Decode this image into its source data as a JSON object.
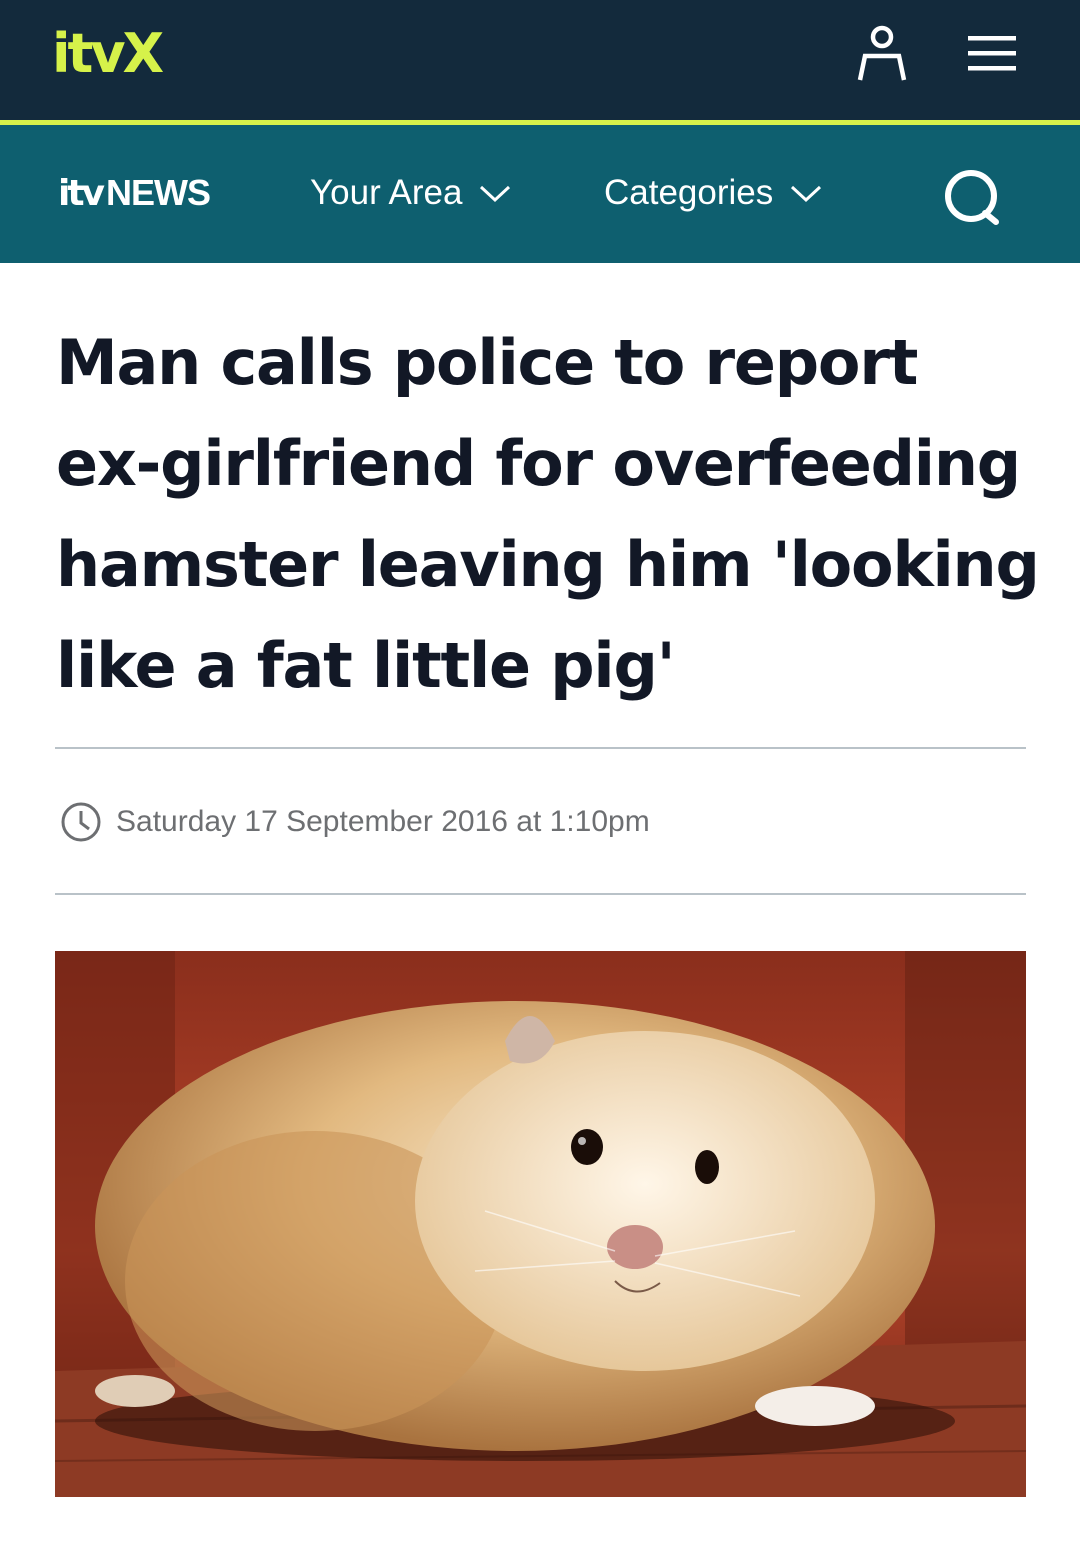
{
  "top_bar": {
    "logo": "itvX",
    "account_icon": "user-icon",
    "menu_icon": "hamburger-menu-icon"
  },
  "news_nav": {
    "logo_prefix": "itv",
    "logo_word": "NEWS",
    "items": [
      {
        "label": "Your Area",
        "icon": "chevron-down-icon"
      },
      {
        "label": "Categories",
        "icon": "chevron-down-icon"
      }
    ],
    "search_icon": "search-icon"
  },
  "article": {
    "headline": "Man calls police to report ex-girlfriend for overfeeding hamster leaving him 'looking like a fat little pig'",
    "date": "Saturday 17 September 2016 at 1:10pm",
    "image_subject": "hamster photo"
  },
  "colors": {
    "top_bar_bg": "#132a3c",
    "accent": "#d6f24a",
    "news_bar_bg": "#0e5f6f",
    "headline_text": "#121826",
    "meta_text": "#6d6f72"
  }
}
